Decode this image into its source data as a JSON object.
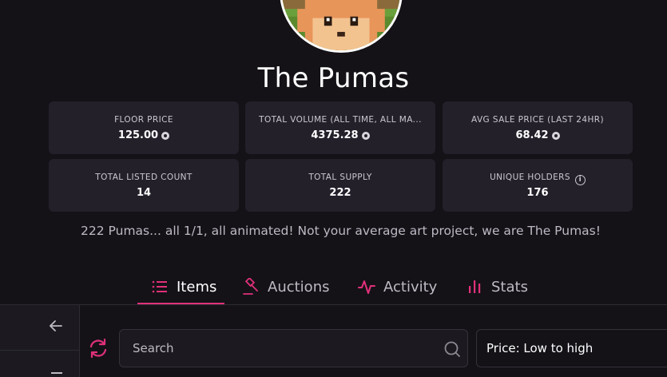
{
  "collection": {
    "title": "The Pumas",
    "description": "222 Pumas... all 1/1, all animated! Not your average art project, we are The Pumas!"
  },
  "stats": [
    {
      "label": "FLOOR PRICE",
      "value": "125.00",
      "currency_icon": "coin-icon"
    },
    {
      "label": "TOTAL VOLUME (ALL TIME, ALL MA...",
      "value": "4375.28",
      "currency_icon": "coin-icon"
    },
    {
      "label": "AVG SALE PRICE (LAST 24HR)",
      "value": "68.42",
      "currency_icon": "coin-icon"
    },
    {
      "label": "TOTAL LISTED COUNT",
      "value": "14"
    },
    {
      "label": "TOTAL SUPPLY",
      "value": "222"
    },
    {
      "label": "UNIQUE HOLDERS",
      "value": "176",
      "info_icon": "info-icon"
    }
  ],
  "tabs": [
    {
      "label": "Items",
      "icon": "list-icon",
      "active": true
    },
    {
      "label": "Auctions",
      "icon": "gavel-icon",
      "active": false
    },
    {
      "label": "Activity",
      "icon": "activity-icon",
      "active": false
    },
    {
      "label": "Stats",
      "icon": "bar-chart-icon",
      "active": false
    }
  ],
  "search": {
    "placeholder": "Search",
    "value": ""
  },
  "sort": {
    "selected": "Price: Low to high"
  },
  "colors": {
    "accent": "#e0307a",
    "background": "#141217",
    "card": "#23202a"
  }
}
